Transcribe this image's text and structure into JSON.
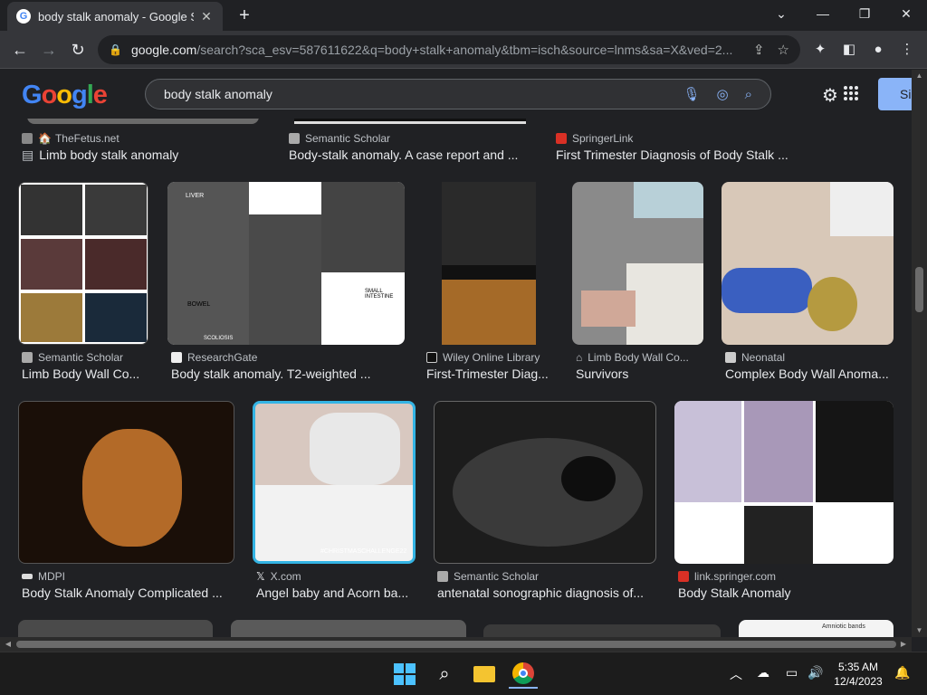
{
  "browser": {
    "tab_title": "body stalk anomaly - Google Se",
    "tab_favicon": "G",
    "url_host": "google.com",
    "url_rest": "/search?sca_esv=587611622&q=body+stalk+anomaly&tbm=isch&source=lnms&sa=X&ved=2..."
  },
  "google": {
    "logo": [
      "G",
      "o",
      "o",
      "g",
      "l",
      "e"
    ],
    "logo_colors": [
      "#4285f4",
      "#ea4335",
      "#fbbc05",
      "#4285f4",
      "#34a853",
      "#ea4335"
    ],
    "query": "body stalk anomaly",
    "signin_label": "Si"
  },
  "top_row": [
    {
      "source": "TheFetus.net",
      "caption": "Limb body stalk anomaly"
    },
    {
      "source": "Semantic Scholar",
      "caption": "Body-stalk anomaly. A case report and ..."
    },
    {
      "source": "SpringerLink",
      "caption": "First Trimester Diagnosis of Body Stalk ..."
    }
  ],
  "row2": [
    {
      "source": "Semantic Scholar",
      "caption": "Limb Body Wall Co..."
    },
    {
      "source": "ResearchGate",
      "caption": "Body stalk anomaly. T2-weighted ...",
      "labels": [
        "LIVER",
        "BOWEL",
        "SCOLIOSIS",
        "SMALL INTESTINE"
      ]
    },
    {
      "source": "Wiley Online Library",
      "caption": "First-Trimester Diag..."
    },
    {
      "source": "Limb Body Wall Co...",
      "caption": "Survivors"
    },
    {
      "source": "Neonatal",
      "caption": "Complex Body Wall Anoma..."
    }
  ],
  "row3": [
    {
      "source": "MDPI",
      "caption": "Body Stalk Anomaly Complicated ..."
    },
    {
      "source": "X.com",
      "caption": "Angel baby and Acorn ba...",
      "overlay": "#CHRISTMASCHALLENGE22"
    },
    {
      "source": "Semantic Scholar",
      "caption": "antenatal sonographic diagnosis of..."
    },
    {
      "source": "link.springer.com",
      "caption": "Body Stalk Anomaly"
    }
  ],
  "row4_partial_text": "Amniotic bands",
  "taskbar": {
    "time": "5:35 AM",
    "date": "12/4/2023"
  }
}
